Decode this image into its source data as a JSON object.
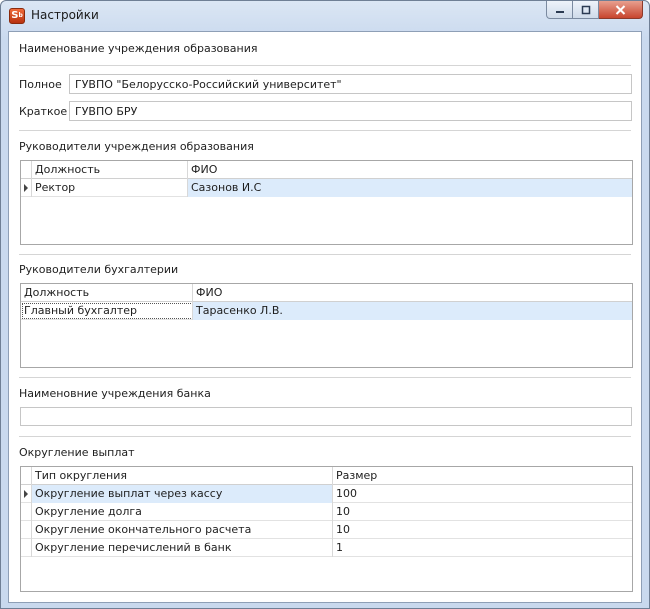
{
  "window": {
    "title": "Настройки",
    "app_icon": "S",
    "app_icon_sub": "b",
    "caption_buttons": [
      "minimize-icon",
      "maximize-icon",
      "close-icon"
    ]
  },
  "institution": {
    "section_title": "Наименование учреждения образования",
    "full_label": "Полное",
    "full_value": "ГУВПО \"Белорусско-Российский университет\"",
    "short_label": "Краткое",
    "short_value": "ГУВПО БРУ"
  },
  "heads": {
    "section_title": "Руководители учреждения образования",
    "columns": [
      "Должность",
      "ФИО"
    ],
    "rows": [
      [
        "Ректор",
        "Сазонов И.С"
      ]
    ]
  },
  "accounting": {
    "section_title": "Руководители бухгалтерии",
    "columns": [
      "Должность",
      "ФИО"
    ],
    "rows": [
      [
        "Главный бухгалтер",
        "Тарасенко Л.В."
      ]
    ]
  },
  "bank": {
    "section_title": "Наименовние учреждения банка",
    "value": ""
  },
  "rounding": {
    "section_title": "Округление выплат",
    "columns": [
      "Тип округления",
      "Размер"
    ],
    "rows": [
      [
        "Округление выплат через кассу",
        "100"
      ],
      [
        "Округление долга",
        "10"
      ],
      [
        "Округление окончательного расчета",
        "10"
      ],
      [
        "Округление перечислений в банк",
        "1"
      ]
    ]
  }
}
